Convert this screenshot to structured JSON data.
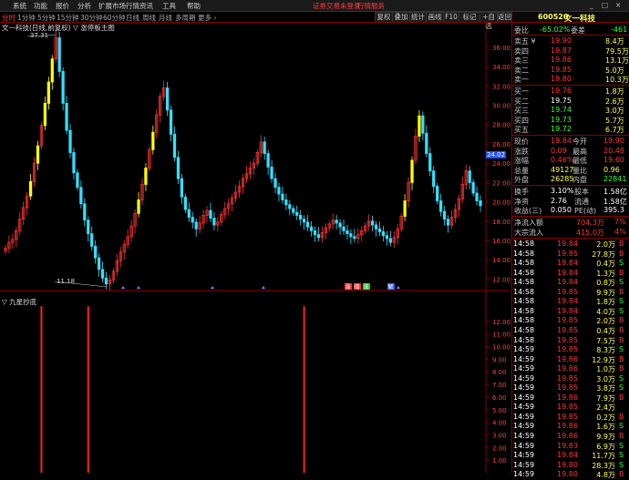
{
  "menu": {
    "items": [
      "系统",
      "功能",
      "报价",
      "分析",
      "扩展市场行情",
      "资讯",
      "工具",
      "帮助"
    ],
    "notice": "证券交易未登录",
    "notice2": "行情服务",
    "window_btns": [
      "_",
      "□",
      "×"
    ]
  },
  "periods": {
    "items": [
      "分时",
      "1分钟",
      "5分钟",
      "15分钟",
      "30分钟",
      "60分钟",
      "日线",
      "周线",
      "月线",
      "多周期",
      "更多 ›"
    ],
    "active_index": 0
  },
  "toolbar": {
    "buttons": [
      "复权",
      "叠加",
      "统计",
      "画线",
      "F10",
      "标记",
      "+自选",
      "返回"
    ]
  },
  "stock": {
    "code": "600520",
    "name": "文一科技"
  },
  "main_chart": {
    "title": "文一科技(日线,前复权) ▽ 涨停板主图",
    "y_ticks": [
      "36.00",
      "34.00",
      "32.00",
      "30.00",
      "28.00",
      "26.00",
      "24.00",
      "22.00",
      "20.00",
      "18.00",
      "16.00",
      "14.00",
      "12.00"
    ],
    "price_marker": "24.02",
    "high_label": "37.31",
    "low_label": "11.18",
    "signal_tags": [
      "涨",
      "增",
      "涨",
      "解"
    ]
  },
  "sub_chart": {
    "title": "▽ 九星抄底",
    "y_ticks": [
      "12.00",
      "11.00",
      "10.00",
      "9.00",
      "8.00",
      "7.00",
      "6.00",
      "5.00",
      "4.00",
      "3.00",
      "2.00",
      "1.00"
    ]
  },
  "colors": {
    "up": "#ff3333",
    "down": "#33e0ff",
    "limit_up": "#ffff00",
    "grid": "#8b0000",
    "panel_border": "#8b0000"
  },
  "chart_data": {
    "type": "candlestick",
    "title": "文一科技(日线,前复权)",
    "ylim": [
      11,
      37.5
    ],
    "candles_close": [
      15.2,
      15.8,
      16.1,
      17.0,
      18.2,
      19.4,
      20.6,
      22.1,
      24.0,
      25.8,
      27.9,
      30.2,
      32.4,
      34.8,
      37.0,
      33.5,
      30.2,
      27.4,
      25.1,
      23.0,
      21.5,
      19.8,
      18.1,
      16.7,
      15.4,
      14.2,
      13.0,
      12.1,
      11.5,
      11.9,
      12.8,
      13.9,
      14.8,
      15.6,
      16.4,
      17.5,
      18.8,
      20.2,
      21.8,
      23.5,
      25.4,
      27.2,
      29.0,
      30.9,
      31.8,
      29.5,
      27.0,
      24.6,
      22.4,
      20.5,
      19.2,
      18.4,
      17.9,
      17.2,
      17.8,
      18.6,
      19.1,
      18.3,
      17.6,
      17.9,
      18.7,
      19.3,
      19.8,
      20.4,
      21.0,
      21.6,
      22.4,
      22.9,
      23.5,
      24.0,
      25.1,
      26.2,
      25.0,
      23.6,
      22.4,
      21.5,
      20.8,
      20.2,
      19.7,
      19.3,
      18.9,
      18.6,
      18.2,
      17.9,
      17.4,
      17.0,
      16.6,
      16.3,
      16.8,
      17.3,
      17.7,
      18.1,
      17.8,
      17.4,
      17.0,
      16.7,
      16.4,
      16.2,
      16.6,
      17.0,
      17.5,
      18.0,
      17.6,
      17.2,
      16.9,
      16.5,
      16.2,
      15.8,
      16.3,
      17.2,
      18.5,
      20.1,
      22.0,
      24.3,
      26.8,
      28.9,
      27.1,
      25.0,
      23.2,
      21.6,
      20.1,
      19.0,
      18.2,
      17.6,
      18.4,
      19.2,
      20.3,
      21.8,
      23.2,
      22.0,
      20.9,
      20.1,
      19.6
    ],
    "limit_up_flags": [
      0,
      0,
      0,
      0,
      0,
      0,
      0,
      1,
      0,
      1,
      0,
      1,
      1,
      1,
      0,
      0,
      0,
      0,
      0,
      0,
      0,
      0,
      0,
      0,
      0,
      0,
      0,
      0,
      0,
      0,
      0,
      0,
      0,
      0,
      0,
      0,
      0,
      1,
      0,
      1,
      0,
      1,
      0,
      0,
      0,
      0,
      0,
      0,
      0,
      0,
      0,
      0,
      0,
      0,
      0,
      0,
      0,
      0,
      0,
      0,
      0,
      0,
      0,
      0,
      0,
      0,
      0,
      0,
      0,
      0,
      0,
      0,
      0,
      0,
      0,
      0,
      0,
      0,
      0,
      0,
      0,
      0,
      0,
      0,
      0,
      0,
      0,
      0,
      0,
      0,
      0,
      0,
      0,
      0,
      0,
      0,
      0,
      0,
      0,
      0,
      0,
      0,
      0,
      0,
      0,
      0,
      0,
      0,
      0,
      0,
      0,
      1,
      0,
      1,
      0,
      1,
      0,
      0,
      0,
      0,
      0,
      0,
      0,
      0,
      0,
      0,
      0,
      0,
      0,
      0,
      0,
      0,
      0,
      0,
      0
    ],
    "signal_bars_sub": [
      10,
      23,
      83
    ],
    "signal_value": 13.2
  },
  "quote": {
    "weibi": {
      "label": "委比",
      "value": "-65.02%",
      "label2": "委差",
      "value2": "-461"
    },
    "sell": [
      {
        "label": "卖五 ¥",
        "price": "19.90",
        "vol": "8.4万"
      },
      {
        "label": "卖四",
        "price": "19.87",
        "vol": "79.5万"
      },
      {
        "label": "卖三",
        "price": "19.86",
        "vol": "13.1万"
      },
      {
        "label": "卖二",
        "price": "19.85",
        "vol": "5.0万"
      },
      {
        "label": "卖一",
        "price": "19.80",
        "vol": "10.3万"
      }
    ],
    "buy": [
      {
        "label": "买一",
        "price": "19.76",
        "vol": "1.8万"
      },
      {
        "label": "买二",
        "price": "19.75",
        "vol": "2.6万"
      },
      {
        "label": "买三",
        "price": "19.74",
        "vol": "3.0万"
      },
      {
        "label": "买四",
        "price": "19.73",
        "vol": "5.7万"
      },
      {
        "label": "买五",
        "price": "19.72",
        "vol": "6.7万"
      }
    ],
    "stats": [
      {
        "l1": "现价",
        "v1": "19.84",
        "l2": "今开",
        "v2": "19.90"
      },
      {
        "l1": "涨跌",
        "v1": "0.09",
        "l2": "最高",
        "v2": "20.48"
      },
      {
        "l1": "涨幅",
        "v1": "0.46%",
        "l2": "最低",
        "v2": "19.60"
      },
      {
        "l1": "总量",
        "v1": "49127",
        "l2": "量比",
        "v2": "0.96"
      },
      {
        "l1": "外盘",
        "v1": "26285",
        "l2": "内盘",
        "v2": "22841"
      }
    ],
    "stats2": [
      {
        "l1": "换手",
        "v1": "3.10%",
        "l2": "股本",
        "v2": "1.58亿"
      },
      {
        "l1": "净资",
        "v1": "2.76",
        "l2": "流通",
        "v2": "1.58亿"
      },
      {
        "l1": "收益(三)",
        "v1": "0.050",
        "l2": "PE(动)",
        "v2": "395.3"
      }
    ],
    "flow": [
      {
        "label": "净流入额",
        "value": "704.3万",
        "pct": "7%"
      },
      {
        "label": "大宗流入",
        "value": "415.0万",
        "pct": "4%"
      }
    ]
  },
  "ticks": [
    {
      "t": "14:58",
      "p": "19.84",
      "v": "2.0万",
      "s": "B"
    },
    {
      "t": "14:58",
      "p": "19.85",
      "v": "27.8万",
      "s": "B"
    },
    {
      "t": "14:58",
      "p": "19.84",
      "v": "0.4万",
      "s": "S"
    },
    {
      "t": "14:58",
      "p": "19.84",
      "v": "1.3万",
      "s": "B"
    },
    {
      "t": "14:58",
      "p": "19.84",
      "v": "0.8万",
      "s": "S"
    },
    {
      "t": "14:58",
      "p": "19.85",
      "v": "9.9万",
      "s": "B"
    },
    {
      "t": "14:58",
      "p": "19.84",
      "v": "1.8万",
      "s": "S"
    },
    {
      "t": "14:58",
      "p": "19.84",
      "v": "4.0万",
      "s": "S"
    },
    {
      "t": "14:58",
      "p": "19.85",
      "v": "2.0万",
      "s": "B"
    },
    {
      "t": "14:58",
      "p": "19.85",
      "v": "0.4万",
      "s": "B"
    },
    {
      "t": "14:58",
      "p": "19.85",
      "v": "7.5万",
      "s": "B"
    },
    {
      "t": "14:59",
      "p": "19.85",
      "v": "8.3万",
      "s": "S"
    },
    {
      "t": "14:59",
      "p": "19.86",
      "v": "12.9万",
      "s": "B"
    },
    {
      "t": "14:59",
      "p": "19.86",
      "v": "1.0万",
      "s": "B"
    },
    {
      "t": "14:59",
      "p": "19.85",
      "v": "3.0万",
      "s": "S"
    },
    {
      "t": "14:59",
      "p": "19.85",
      "v": "3.8万",
      "s": "S"
    },
    {
      "t": "14:59",
      "p": "19.86",
      "v": "7.9万",
      "s": "B"
    },
    {
      "t": "14:59",
      "p": "19.85",
      "v": "2.4万",
      "s": ""
    },
    {
      "t": "14:59",
      "p": "19.85",
      "v": "0.2万",
      "s": "B"
    },
    {
      "t": "14:59",
      "p": "19.86",
      "v": "1.6万",
      "s": "S"
    },
    {
      "t": "14:59",
      "p": "19.86",
      "v": "9.9万",
      "s": "B"
    },
    {
      "t": "14:59",
      "p": "19.83",
      "v": "6.9万",
      "s": "S"
    },
    {
      "t": "14:59",
      "p": "19.84",
      "v": "11.7万",
      "s": "S"
    },
    {
      "t": "14:59",
      "p": "19.80",
      "v": "28.3万",
      "s": "S"
    },
    {
      "t": "14:59",
      "p": "19.80",
      "v": "4.8万",
      "s": "B"
    }
  ]
}
